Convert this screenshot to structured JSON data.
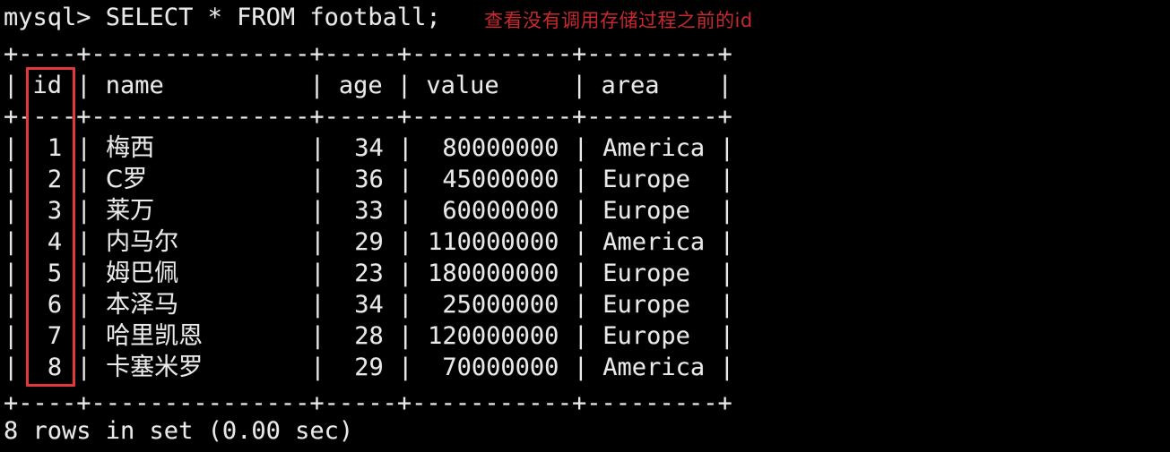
{
  "terminal": {
    "background_color": "#000000",
    "text_color": "#e9e9e9",
    "accent_red": "#e4373c",
    "annotation_color": "#c8282f",
    "prompt": "mysql> ",
    "query": "SELECT * FROM football;",
    "prompt_line": "mysql> SELECT * FROM football;",
    "annotation": "查看没有调用存储过程之前的id",
    "separator": "+----+---------------+-----+-----------+---------+",
    "header_line": "| id | name          | age | value     | area    |",
    "footer": "8 rows in set (0.00 sec)",
    "row_count_label": "8 rows in set",
    "duration_label": "(0.00 sec)"
  },
  "highlight": {
    "target_column": "id",
    "color": "#e4373c",
    "label": "id-column-highlight"
  },
  "table": {
    "name": "football",
    "columns": [
      {
        "name": "id",
        "width": 4,
        "align": "right"
      },
      {
        "name": "name",
        "width": 15,
        "align": "left"
      },
      {
        "name": "age",
        "width": 5,
        "align": "right"
      },
      {
        "name": "value",
        "width": 11,
        "align": "right"
      },
      {
        "name": "area",
        "width": 9,
        "align": "left"
      }
    ],
    "headers": [
      "id",
      "name",
      "age",
      "value",
      "area"
    ],
    "rows": [
      {
        "id": "1",
        "name": "梅西",
        "age": "34",
        "value": "80000000",
        "area": "America"
      },
      {
        "id": "2",
        "name": "C罗",
        "age": "36",
        "value": "45000000",
        "area": "Europe"
      },
      {
        "id": "3",
        "name": "莱万",
        "age": "33",
        "value": "60000000",
        "area": "Europe"
      },
      {
        "id": "4",
        "name": "内马尔",
        "age": "29",
        "value": "110000000",
        "area": "America"
      },
      {
        "id": "5",
        "name": "姆巴佩",
        "age": "23",
        "value": "180000000",
        "area": "Europe"
      },
      {
        "id": "6",
        "name": "本泽马",
        "age": "34",
        "value": "25000000",
        "area": "Europe"
      },
      {
        "id": "7",
        "name": "哈里凯恩",
        "age": "28",
        "value": "120000000",
        "area": "Europe"
      },
      {
        "id": "8",
        "name": "卡塞米罗",
        "age": "29",
        "value": "70000000",
        "area": "America"
      }
    ],
    "row_lines": [
      "|  1 | 梅西          |  34 |  80000000 | America |",
      "|  2 | C罗           |  36 |  45000000 | Europe  |",
      "|  3 | 莱万          |  33 |  60000000 | Europe  |",
      "|  4 | 内马尔        |  29 | 110000000 | America |",
      "|  5 | 姆巴佩        |  23 | 180000000 | Europe  |",
      "|  6 | 本泽马        |  34 |  25000000 | Europe  |",
      "|  7 | 哈里凯恩      |  28 | 120000000 | Europe  |",
      "|  8 | 卡塞米罗      |  29 |  70000000 | America |"
    ]
  }
}
